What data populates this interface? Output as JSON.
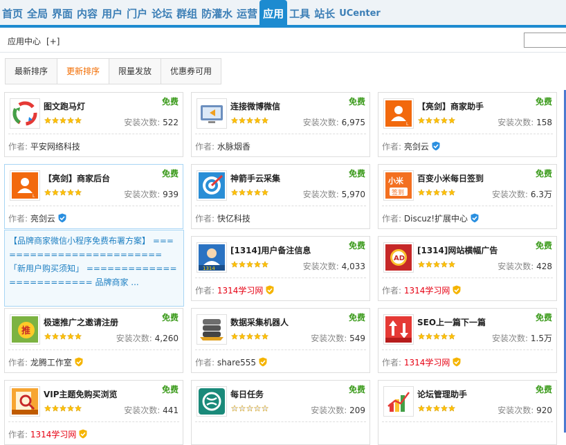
{
  "nav": [
    "首页",
    "全局",
    "界面",
    "内容",
    "用户",
    "门户",
    "论坛",
    "群组",
    "防灌水",
    "运营",
    "应用",
    "工具",
    "站长",
    "UCenter"
  ],
  "nav_active": "应用",
  "subbar": {
    "title": "应用中心",
    "plus": "[+]"
  },
  "tabs": [
    "最新排序",
    "更新排序",
    "限量发放",
    "优惠券可用"
  ],
  "tab_active": "更新排序",
  "labels": {
    "free": "免费",
    "installs": "安装次数:",
    "author": "作者:"
  },
  "cards": [
    {
      "name": "图文跑马灯",
      "installs": "522",
      "author": "平安网络科技",
      "author_red": false,
      "verified": false,
      "icon": "carousel-icon",
      "stars": 5
    },
    {
      "name": "连接微博微信",
      "installs": "6,975",
      "author": "水脉烟香",
      "author_red": false,
      "verified": false,
      "icon": "monitor-arrow-icon",
      "stars": 5
    },
    {
      "name": "【亮剑】商家助手",
      "installs": "158",
      "author": "亮剑云",
      "author_red": false,
      "verified": "blue",
      "icon": "merchant-icon",
      "stars": 5
    },
    {
      "name": "【亮剑】商家后台",
      "installs": "939",
      "author": "亮剑云",
      "author_red": false,
      "verified": "blue",
      "icon": "merchant-icon",
      "stars": 5
    },
    {
      "name": "神箭手云采集",
      "installs": "5,970",
      "author": "快亿科技",
      "author_red": false,
      "verified": false,
      "icon": "target-icon",
      "stars": 5
    },
    {
      "name": "百变小米每日签到",
      "installs": "6.3万",
      "author": "Discuz!扩展中心",
      "author_red": false,
      "verified": "blue",
      "icon": "xiaomi-sign-icon",
      "stars": 5
    },
    {
      "name": "[1314]用户备注信息",
      "installs": "4,033",
      "author": "1314学习网",
      "author_red": true,
      "verified": "gold",
      "icon": "user-info-icon",
      "stars": 5
    },
    {
      "name": "[1314]网站横幅广告",
      "installs": "428",
      "author": "1314学习网",
      "author_red": true,
      "verified": "gold",
      "icon": "ad-icon",
      "stars": 5
    },
    {
      "name": "极速推广之邀请注册",
      "installs": "4,260",
      "author": "龙腾工作室",
      "author_red": false,
      "verified": "gold",
      "icon": "promote-icon",
      "stars": 5
    },
    {
      "name": "数据采集机器人",
      "installs": "549",
      "author": "share555",
      "author_red": false,
      "verified": "gold",
      "icon": "data-robot-icon",
      "stars": 5
    },
    {
      "name": "SEO上一篇下一篇",
      "installs": "1.5万",
      "author": "1314学习网",
      "author_red": true,
      "verified": "gold",
      "icon": "updown-icon",
      "stars": 5
    },
    {
      "name": "VIP主题免购买浏览",
      "installs": "441",
      "author": "1314学习网",
      "author_red": true,
      "verified": "gold",
      "icon": "vip-search-icon",
      "stars": 5
    },
    {
      "name": "每日任务",
      "installs": "209",
      "author": "",
      "author_red": false,
      "verified": false,
      "icon": "daily-task-icon",
      "stars": 0
    },
    {
      "name": "论坛管理助手",
      "installs": "920",
      "author": "",
      "author_red": false,
      "verified": false,
      "icon": "chart-bars-icon",
      "stars": 5
    }
  ],
  "popup": {
    "text": "【品牌商家微信小程序免费布署方案】 ========================= 「新用户购买须知」 ========================= 品牌商家 ..."
  },
  "colors": {
    "nav_blue": "#1d8bd0",
    "free_green": "#3a9a1a",
    "tab_orange": "#f26c00",
    "red": "#e60012"
  }
}
